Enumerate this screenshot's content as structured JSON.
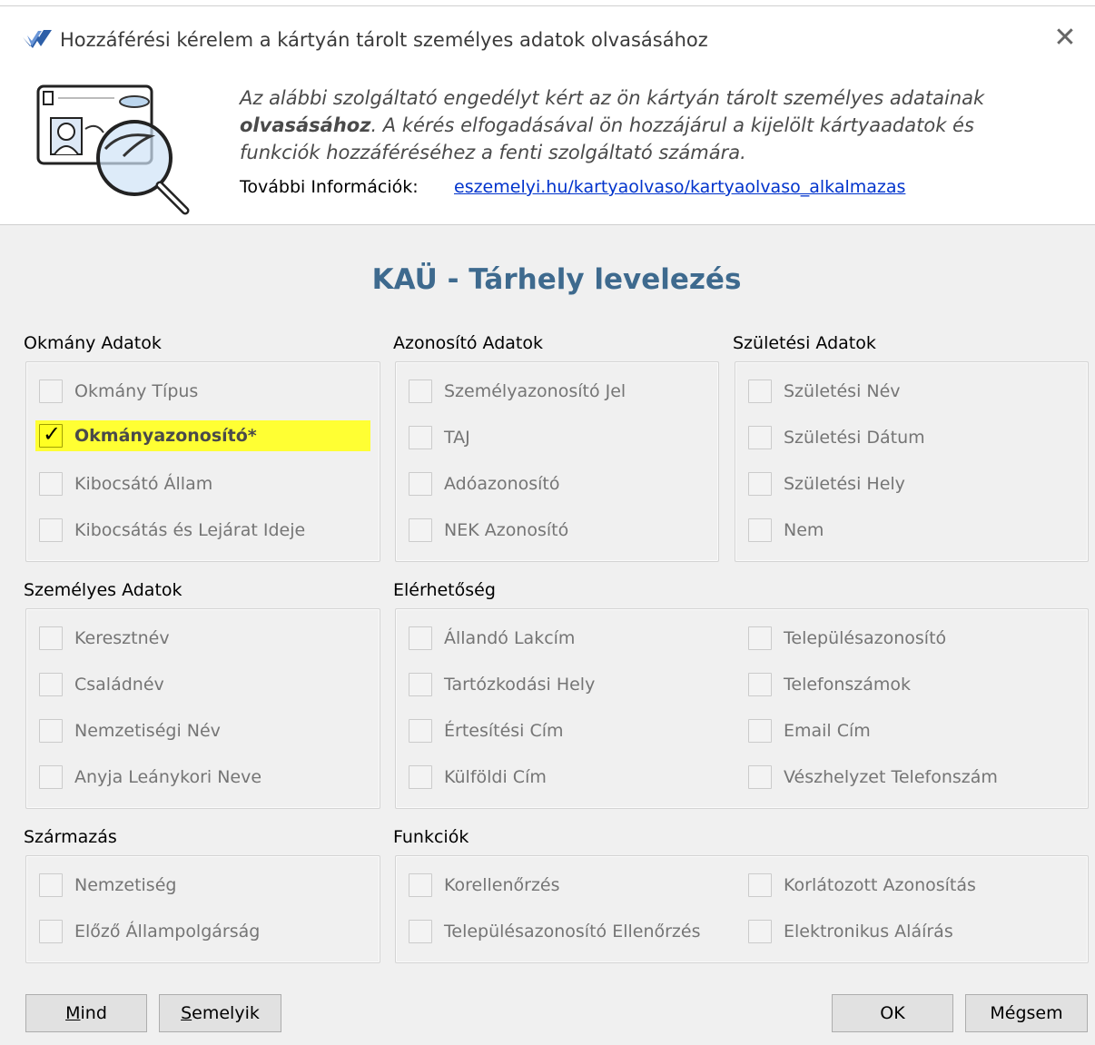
{
  "window": {
    "title": "Hozzáférési kérelem a kártyán tárolt személyes adatok olvasásához",
    "close_icon": "close-icon",
    "logo_icon": "app-logo-icon"
  },
  "description": {
    "part1": "Az alábbi szolgáltató engedélyt kért az ön kártyán tárolt személyes adatainak ",
    "bold": "olvasásához",
    "part2": ". A kérés elfogadásával ön hozzájárul a kijelölt kártyaadatok és funkciók hozzáféréséhez a fenti szolgáltató számára."
  },
  "more_info": {
    "label": "További Információk:",
    "link": "eszemelyi.hu/kartyaolvaso/kartyaolvaso_alkalmazas"
  },
  "service_title": "KAÜ - Tárhely levelezés",
  "groups": {
    "okmany": {
      "label": "Okmány Adatok",
      "items": [
        {
          "label": "Okmány Típus",
          "checked": false
        },
        {
          "label": "Okmányazonosító*",
          "checked": true
        },
        {
          "label": "Kibocsátó Állam",
          "checked": false
        },
        {
          "label": "Kibocsátás és Lejárat Ideje",
          "checked": false
        }
      ]
    },
    "azonosito": {
      "label": "Azonosító Adatok",
      "items": [
        {
          "label": "Személyazonosító Jel",
          "checked": false
        },
        {
          "label": "TAJ",
          "checked": false
        },
        {
          "label": "Adóazonosító",
          "checked": false
        },
        {
          "label": "NEK Azonosító",
          "checked": false
        }
      ]
    },
    "szuletesi": {
      "label": "Születési Adatok",
      "items": [
        {
          "label": "Születési Név",
          "checked": false
        },
        {
          "label": "Születési Dátum",
          "checked": false
        },
        {
          "label": "Születési Hely",
          "checked": false
        },
        {
          "label": "Nem",
          "checked": false
        }
      ]
    },
    "szemelyes": {
      "label": "Személyes Adatok",
      "items": [
        {
          "label": "Keresztnév",
          "checked": false
        },
        {
          "label": "Családnév",
          "checked": false
        },
        {
          "label": "Nemzetiségi Név",
          "checked": false
        },
        {
          "label": "Anyja Leánykori Neve",
          "checked": false
        }
      ]
    },
    "elerhetoseg": {
      "label": "Elérhetőség",
      "items": [
        {
          "label": "Állandó Lakcím",
          "checked": false
        },
        {
          "label": "Tartózkodási Hely",
          "checked": false
        },
        {
          "label": "Értesítési Cím",
          "checked": false
        },
        {
          "label": "Külföldi Cím",
          "checked": false
        },
        {
          "label": "Településazonosító",
          "checked": false
        },
        {
          "label": "Telefonszámok",
          "checked": false
        },
        {
          "label": "Email Cím",
          "checked": false
        },
        {
          "label": "Vészhelyzet Telefonszám",
          "checked": false
        }
      ]
    },
    "szarmazas": {
      "label": "Származás",
      "items": [
        {
          "label": "Nemzetiség",
          "checked": false
        },
        {
          "label": "Előző Állampolgárság",
          "checked": false
        }
      ]
    },
    "funkciok": {
      "label": "Funkciók",
      "items": [
        {
          "label": "Korellenőrzés",
          "checked": false
        },
        {
          "label": "Településazonosító Ellenőrzés",
          "checked": false
        },
        {
          "label": "Korlátozott Azonosítás",
          "checked": false
        },
        {
          "label": "Elektronikus Aláírás",
          "checked": false
        }
      ]
    }
  },
  "buttons": {
    "all_key": "M",
    "all_rest": "ind",
    "none_key": "S",
    "none_rest": "emelyik",
    "ok": "OK",
    "cancel": "Mégsem"
  },
  "colors": {
    "title": "#3e6a8e",
    "highlight": "#ffff33",
    "link": "#0033cc"
  }
}
